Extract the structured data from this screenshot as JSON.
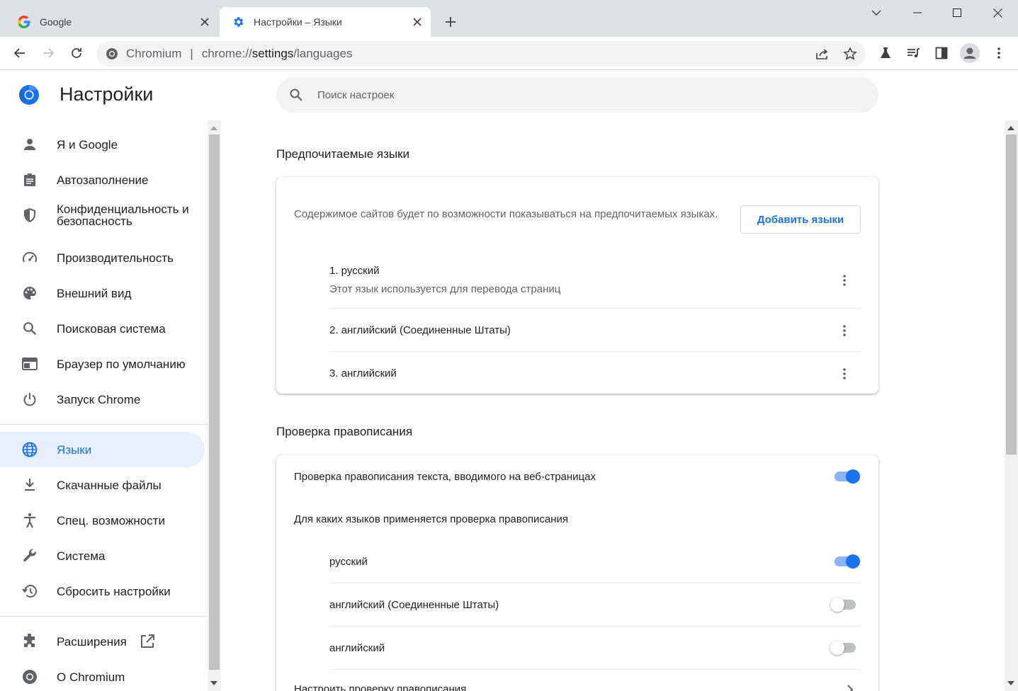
{
  "tabs": [
    {
      "title": "Google",
      "icon": "google-g-icon",
      "active": false
    },
    {
      "title": "Настройки – Языки",
      "icon": "gear-icon",
      "active": true
    }
  ],
  "toolbar": {
    "host": "Chromium",
    "url_scheme": "chrome://",
    "url_host": "settings",
    "url_path": "/languages"
  },
  "header": {
    "title": "Настройки",
    "search_placeholder": "Поиск настроек"
  },
  "sidebar": {
    "items": [
      {
        "label": "Я и Google",
        "icon": "person-icon"
      },
      {
        "label": "Автозаполнение",
        "icon": "clipboard-icon"
      },
      {
        "label": "Конфиденциальность и безопасность",
        "icon": "shield-icon"
      },
      {
        "label": "Производительность",
        "icon": "speedometer-icon"
      },
      {
        "label": "Внешний вид",
        "icon": "palette-icon"
      },
      {
        "label": "Поисковая система",
        "icon": "search-icon"
      },
      {
        "label": "Браузер по умолчанию",
        "icon": "browser-window-icon"
      },
      {
        "label": "Запуск Chrome",
        "icon": "power-icon"
      },
      {
        "label": "Языки",
        "icon": "globe-icon",
        "selected": true
      },
      {
        "label": "Скачанные файлы",
        "icon": "download-icon"
      },
      {
        "label": "Спец. возможности",
        "icon": "accessibility-icon"
      },
      {
        "label": "Система",
        "icon": "wrench-icon"
      },
      {
        "label": "Сбросить настройки",
        "icon": "restore-icon"
      },
      {
        "label": "Расширения",
        "icon": "puzzle-icon"
      },
      {
        "label": "О Chromium",
        "icon": "chromium-icon"
      }
    ]
  },
  "preferred": {
    "title": "Предпочитаемые языки",
    "description": "Содержимое сайтов будет по возможности показываться на предпочитаемых языках.",
    "add_button": "Добавить языки",
    "languages": [
      {
        "label": "1. русский",
        "sub": "Этот язык используется для перевода страниц"
      },
      {
        "label": "2. английский (Соединенные Штаты)"
      },
      {
        "label": "3. английский"
      }
    ]
  },
  "spellcheck": {
    "title": "Проверка правописания",
    "main_toggle_label": "Проверка правописания текста, вводимого на веб-страницах",
    "main_toggle_on": true,
    "languages_header": "Для каких языков применяется проверка правописания",
    "languages": [
      {
        "label": "русский",
        "on": true
      },
      {
        "label": "английский (Соединенные Штаты)",
        "on": false
      },
      {
        "label": "английский",
        "on": false
      }
    ],
    "customize_label": "Настроить проверку правописания"
  },
  "colors": {
    "accent": "#1a73e8",
    "selected_bg": "#e8f0fe",
    "toggle_track_on": "#8ab4f8"
  }
}
